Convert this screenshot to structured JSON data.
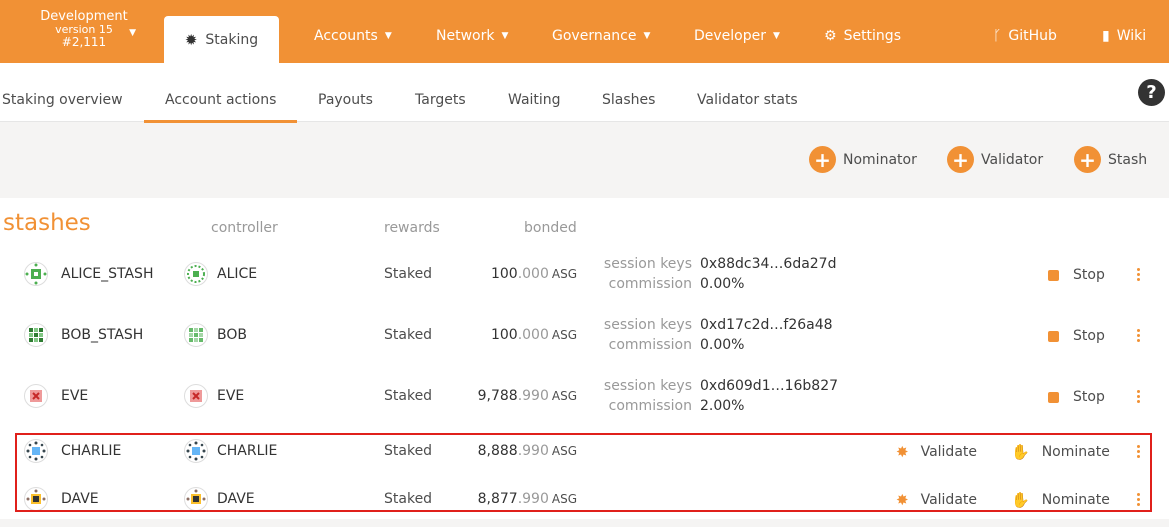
{
  "chain": {
    "name": "Development",
    "version": "version 15",
    "block": "#2,111"
  },
  "topnav": {
    "staking": "Staking",
    "accounts": "Accounts",
    "network": "Network",
    "governance": "Governance",
    "developer": "Developer",
    "settings": "Settings",
    "github": "GitHub",
    "wiki": "Wiki"
  },
  "subnav": [
    "Staking overview",
    "Account actions",
    "Payouts",
    "Targets",
    "Waiting",
    "Slashes",
    "Validator stats"
  ],
  "help": "?",
  "actions": {
    "nominator": "Nominator",
    "validator": "Validator",
    "stash": "Stash"
  },
  "table": {
    "title": "stashes",
    "headers": {
      "controller": "controller",
      "rewards": "rewards",
      "bonded": "bonded"
    },
    "rows": [
      {
        "stash": "ALICE_STASH",
        "controller": "ALICE",
        "rewards": "Staked",
        "bonded_int": "100",
        "bonded_dec": ".000",
        "unit": "ASG",
        "session_label": "session keys",
        "session_keys": "0x88dc34…6da27d",
        "commission_label": "commission",
        "commission": "0.00%",
        "action": "Stop"
      },
      {
        "stash": "BOB_STASH",
        "controller": "BOB",
        "rewards": "Staked",
        "bonded_int": "100",
        "bonded_dec": ".000",
        "unit": "ASG",
        "session_label": "session keys",
        "session_keys": "0xd17c2d…f26a48",
        "commission_label": "commission",
        "commission": "0.00%",
        "action": "Stop"
      },
      {
        "stash": "EVE",
        "controller": "EVE",
        "rewards": "Staked",
        "bonded_int": "9,788",
        "bonded_dec": ".990",
        "unit": "ASG",
        "session_label": "session keys",
        "session_keys": "0xd609d1…16b827",
        "commission_label": "commission",
        "commission": "2.00%",
        "action": "Stop"
      },
      {
        "stash": "CHARLIE",
        "controller": "CHARLIE",
        "rewards": "Staked",
        "bonded_int": "8,888",
        "bonded_dec": ".990",
        "unit": "ASG",
        "validate": "Validate",
        "nominate": "Nominate"
      },
      {
        "stash": "DAVE",
        "controller": "DAVE",
        "rewards": "Staked",
        "bonded_int": "8,877",
        "bonded_dec": ".990",
        "unit": "ASG",
        "validate": "Validate",
        "nominate": "Nominate"
      }
    ]
  },
  "colors": {
    "accent": "#f19135",
    "highlight": "#e0201b"
  }
}
